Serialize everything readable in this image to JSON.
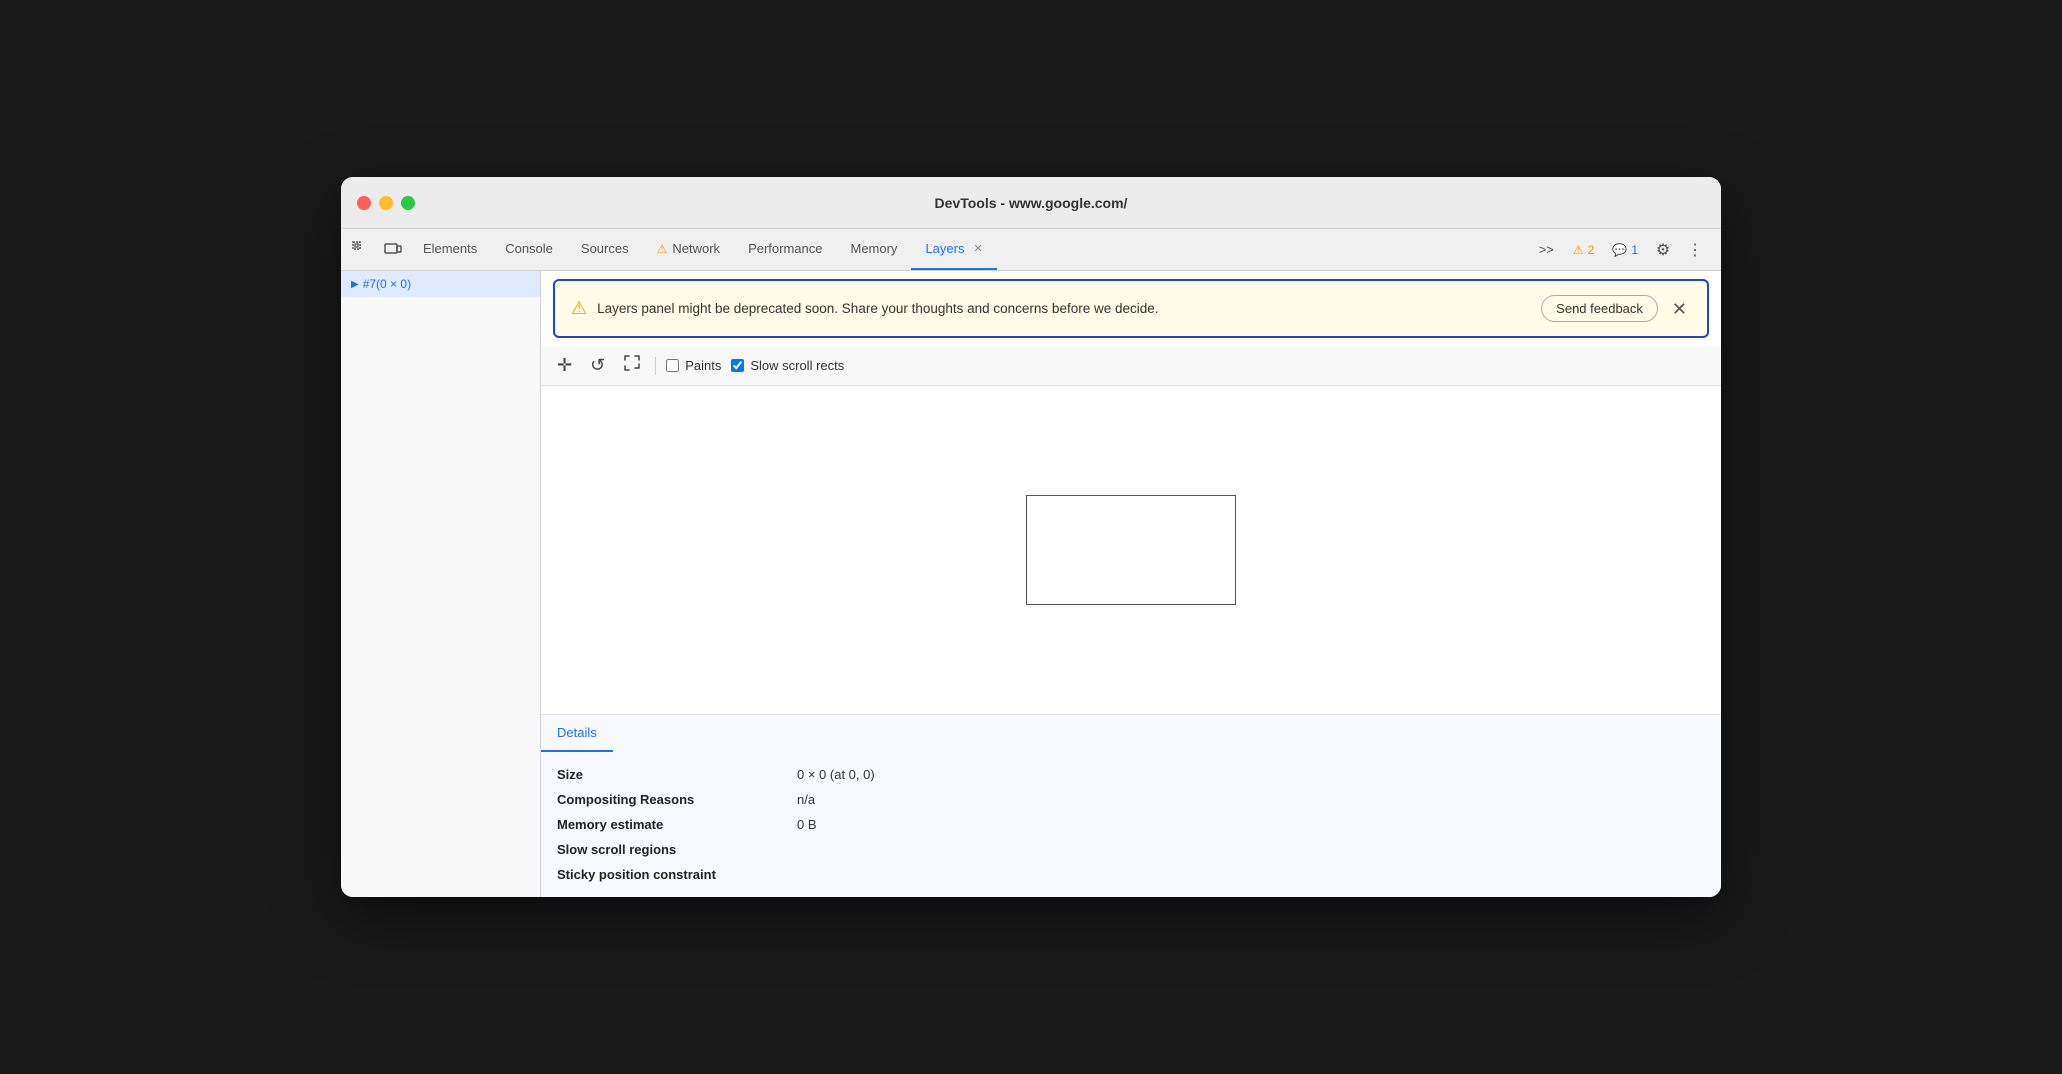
{
  "window": {
    "title": "DevTools - www.google.com/"
  },
  "tabs": [
    {
      "id": "elements",
      "label": "Elements",
      "active": false,
      "warn": false
    },
    {
      "id": "console",
      "label": "Console",
      "active": false,
      "warn": false
    },
    {
      "id": "sources",
      "label": "Sources",
      "active": false,
      "warn": false
    },
    {
      "id": "network",
      "label": "Network",
      "active": false,
      "warn": true
    },
    {
      "id": "performance",
      "label": "Performance",
      "active": false,
      "warn": false
    },
    {
      "id": "memory",
      "label": "Memory",
      "active": false,
      "warn": false
    },
    {
      "id": "layers",
      "label": "Layers",
      "active": true,
      "warn": false
    }
  ],
  "toolbar_right": {
    "more_label": ">>",
    "warn_count": "2",
    "info_count": "1"
  },
  "warning_banner": {
    "message": "Layers panel might be deprecated soon. Share your thoughts and concerns before we decide.",
    "button_label": "Send feedback"
  },
  "layers_toolbar": {
    "pan_icon": "✛",
    "rotate_icon": "↺",
    "fit_icon": "⤢",
    "paints_label": "Paints",
    "paints_checked": false,
    "slow_scroll_label": "Slow scroll rects",
    "slow_scroll_checked": true
  },
  "sidebar": {
    "items": [
      {
        "label": "#7(0 × 0)",
        "selected": true,
        "expandable": true
      }
    ]
  },
  "details": {
    "tab_label": "Details",
    "rows": [
      {
        "key": "Size",
        "value": "0 × 0 (at 0, 0)"
      },
      {
        "key": "Compositing Reasons",
        "value": "n/a"
      },
      {
        "key": "Memory estimate",
        "value": "0 B"
      },
      {
        "key": "Slow scroll regions",
        "value": ""
      },
      {
        "key": "Sticky position constraint",
        "value": ""
      }
    ]
  }
}
